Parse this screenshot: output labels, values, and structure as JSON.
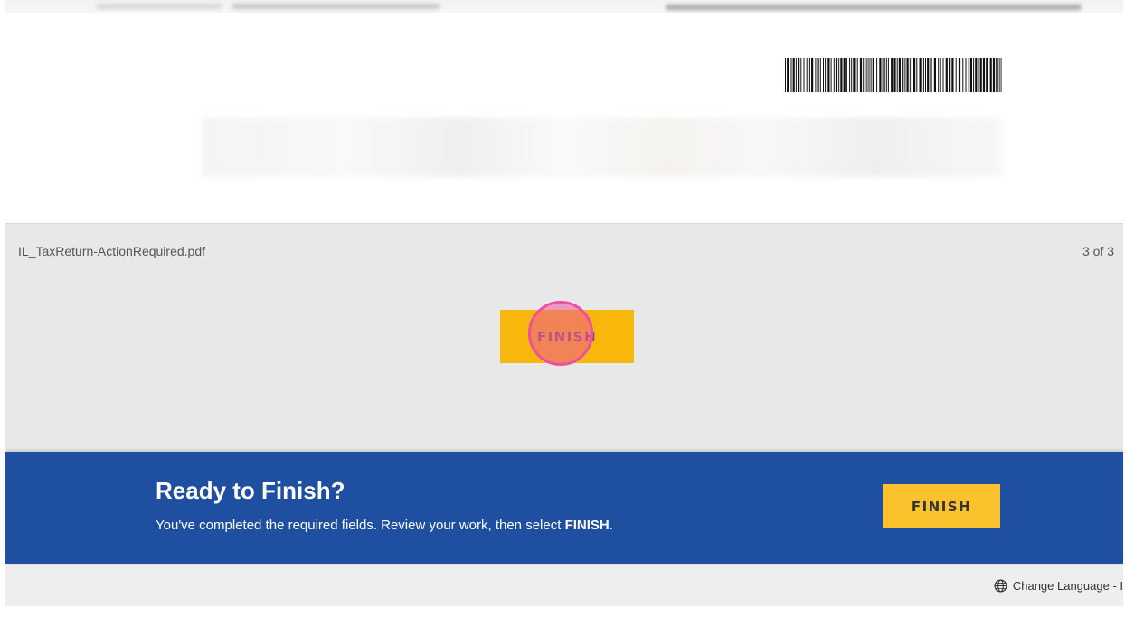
{
  "document": {
    "file_name": "IL_TaxReturn-ActionRequired.pdf",
    "page_indicator": "3 of 3",
    "finish_tag_label": "FINISH"
  },
  "banner": {
    "title": "Ready to Finish?",
    "message_prefix": "You've completed the required fields. Review your work, then select ",
    "message_emphasis": "FINISH",
    "message_suffix": ".",
    "finish_button_label": "FINISH"
  },
  "footer": {
    "language_link": "Change Language - I"
  },
  "icons": {
    "language": "globe-icon",
    "barcode": "barcode-icon"
  },
  "colors": {
    "banner_blue": "#1f4fa0",
    "finish_yellow": "#fcc22d",
    "doc_finish_yellow": "#f7b70b",
    "click_marker": "#ee4fa2",
    "viewer_gray": "#e8e8e8"
  }
}
